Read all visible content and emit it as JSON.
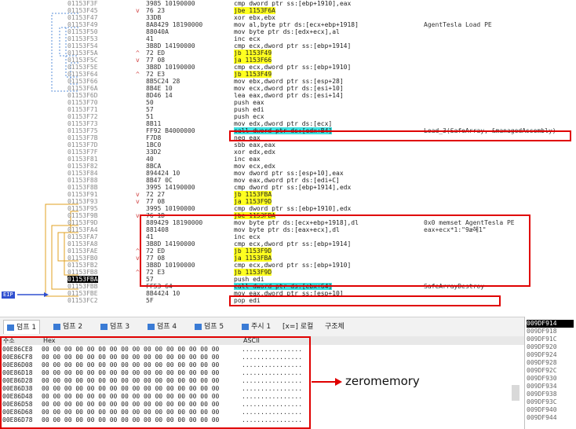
{
  "disasm": [
    {
      "addr": "01153F3F",
      "arrow": "",
      "bytes": "3985 10190000",
      "instr": "cmp dword ptr ss:[ebp+1910],eax",
      "comment": ""
    },
    {
      "addr": "01153F45",
      "arrow": "v",
      "bytes": "76 23",
      "instr": "jbe 1153F6A",
      "comment": ""
    },
    {
      "addr": "01153F47",
      "arrow": "",
      "bytes": "33DB",
      "instr": "xor ebx,ebx",
      "comment": ""
    },
    {
      "addr": "01153F49",
      "arrow": "",
      "bytes": "8A8429 18190000",
      "instr": "mov al,byte ptr ds:[ecx+ebp+1918]",
      "comment": "AgentTesla Load PE"
    },
    {
      "addr": "01153F50",
      "arrow": "",
      "bytes": "88040A",
      "instr": "mov byte ptr ds:[edx+ecx],al",
      "comment": ""
    },
    {
      "addr": "01153F53",
      "arrow": "",
      "bytes": "41",
      "instr": "inc ecx",
      "comment": ""
    },
    {
      "addr": "01153F54",
      "arrow": "",
      "bytes": "3B8D 14190000",
      "instr": "cmp ecx,dword ptr ss:[ebp+1914]",
      "comment": ""
    },
    {
      "addr": "01153F5A",
      "arrow": "^",
      "bytes": "72 ED",
      "instr": "jb 1153F49",
      "comment": ""
    },
    {
      "addr": "01153F5C",
      "arrow": "v",
      "bytes": "77 08",
      "instr": "ja 1153F66",
      "comment": ""
    },
    {
      "addr": "01153F5E",
      "arrow": "",
      "bytes": "3B8D 10190000",
      "instr": "cmp ecx,dword ptr ss:[ebp+1910]",
      "comment": ""
    },
    {
      "addr": "01153F64",
      "arrow": "^",
      "bytes": "72 E3",
      "instr": "jb 1153F49",
      "comment": ""
    },
    {
      "addr": "01153F66",
      "arrow": "",
      "bytes": "8B5C24 28",
      "instr": "mov ebx,dword ptr ss:[esp+28]",
      "comment": ""
    },
    {
      "addr": "01153F6A",
      "arrow": "",
      "bytes": "8B4E 10",
      "instr": "mov ecx,dword ptr ds:[esi+10]",
      "comment": ""
    },
    {
      "addr": "01153F6D",
      "arrow": "",
      "bytes": "8D46 14",
      "instr": "lea eax,dword ptr ds:[esi+14]",
      "comment": ""
    },
    {
      "addr": "01153F70",
      "arrow": "",
      "bytes": "50",
      "instr": "push eax",
      "comment": ""
    },
    {
      "addr": "01153F71",
      "arrow": "",
      "bytes": "57",
      "instr": "push edi",
      "comment": ""
    },
    {
      "addr": "01153F72",
      "arrow": "",
      "bytes": "51",
      "instr": "push ecx",
      "comment": ""
    },
    {
      "addr": "01153F73",
      "arrow": "",
      "bytes": "8B11",
      "instr": "mov edx,dword ptr ds:[ecx]",
      "comment": ""
    },
    {
      "addr": "01153F75",
      "arrow": "",
      "bytes": "FF92 B4000000",
      "instr": "call dword ptr ds:[edx+B4]",
      "comment": "Load_3(SafeArray, &managedAssembly)"
    },
    {
      "addr": "01153F7B",
      "arrow": "",
      "bytes": "F7D8",
      "instr": "neg eax",
      "comment": ""
    },
    {
      "addr": "01153F7D",
      "arrow": "",
      "bytes": "1BC0",
      "instr": "sbb eax,eax",
      "comment": ""
    },
    {
      "addr": "01153F7F",
      "arrow": "",
      "bytes": "33D2",
      "instr": "xor edx,edx",
      "comment": ""
    },
    {
      "addr": "01153F81",
      "arrow": "",
      "bytes": "40",
      "instr": "inc eax",
      "comment": ""
    },
    {
      "addr": "01153F82",
      "arrow": "",
      "bytes": "8BCA",
      "instr": "mov ecx,edx",
      "comment": ""
    },
    {
      "addr": "01153F84",
      "arrow": "",
      "bytes": "894424 10",
      "instr": "mov dword ptr ss:[esp+10],eax",
      "comment": ""
    },
    {
      "addr": "01153F88",
      "arrow": "",
      "bytes": "8B47 0C",
      "instr": "mov eax,dword ptr ds:[edi+C]",
      "comment": ""
    },
    {
      "addr": "01153F8B",
      "arrow": "",
      "bytes": "3995 14190000",
      "instr": "cmp dword ptr ss:[ebp+1914],edx",
      "comment": ""
    },
    {
      "addr": "01153F91",
      "arrow": "v",
      "bytes": "72 27",
      "instr": "jb 1153FBA",
      "comment": ""
    },
    {
      "addr": "01153F93",
      "arrow": "v",
      "bytes": "77 08",
      "instr": "ja 1153F9D",
      "comment": ""
    },
    {
      "addr": "01153F95",
      "arrow": "",
      "bytes": "3995 10190000",
      "instr": "cmp dword ptr ss:[ebp+1910],edx",
      "comment": ""
    },
    {
      "addr": "01153F9B",
      "arrow": "v",
      "bytes": "76 1D",
      "instr": "jbe 1153FBA",
      "comment": ""
    },
    {
      "addr": "01153F9D",
      "arrow": "",
      "bytes": "889429 18190000",
      "instr": "mov byte ptr ds:[ecx+ebp+1918],dl",
      "comment": "0x0 memset AgentTesla PE"
    },
    {
      "addr": "01153FA4",
      "arrow": "",
      "bytes": "881408",
      "instr": "mov byte ptr ds:[eax+ecx],dl",
      "comment": "eax+ecx*1:\"9æ혜1\""
    },
    {
      "addr": "01153FA7",
      "arrow": "",
      "bytes": "41",
      "instr": "inc ecx",
      "comment": ""
    },
    {
      "addr": "01153FA8",
      "arrow": "",
      "bytes": "3B8D 14190000",
      "instr": "cmp ecx,dword ptr ss:[ebp+1914]",
      "comment": ""
    },
    {
      "addr": "01153FAE",
      "arrow": "^",
      "bytes": "72 ED",
      "instr": "jb 1153F9D",
      "comment": ""
    },
    {
      "addr": "01153FB0",
      "arrow": "v",
      "bytes": "77 08",
      "instr": "ja 1153FBA",
      "comment": ""
    },
    {
      "addr": "01153FB2",
      "arrow": "",
      "bytes": "3B8D 10190000",
      "instr": "cmp ecx,dword ptr ss:[ebp+1910]",
      "comment": ""
    },
    {
      "addr": "01153FB8",
      "arrow": "^",
      "bytes": "72 E3",
      "instr": "jb 1153F9D",
      "comment": ""
    },
    {
      "addr": "01153FBA",
      "arrow": "",
      "bytes": "57",
      "instr": "push edi",
      "comment": ""
    },
    {
      "addr": "01153FBB",
      "arrow": "",
      "bytes": "FF53 64",
      "instr": "call dword ptr ds:[ebx+64]",
      "comment": "SafeArrayDestroy"
    },
    {
      "addr": "01153FBE",
      "arrow": "",
      "bytes": "8B4424 10",
      "instr": "mov eax,dword ptr ss:[esp+10]",
      "comment": ""
    },
    {
      "addr": "01153FC2",
      "arrow": "",
      "bytes": "5F",
      "instr": "pop edi",
      "comment": ""
    }
  ],
  "eip_label": "EIP",
  "tabs": [
    {
      "label": "덤프 1"
    },
    {
      "label": "덤프 2"
    },
    {
      "label": "덤프 3"
    },
    {
      "label": "덤프 4"
    },
    {
      "label": "덤프 5"
    },
    {
      "label": "주시 1"
    },
    {
      "label": "[x=] 로컬"
    },
    {
      "label": "구조체"
    }
  ],
  "dump": {
    "head_addr": "주소",
    "head_hex": "Hex",
    "head_ascii": "ASCII",
    "rows": [
      {
        "addr": "00E86CE8",
        "hex": "00 00 00 00 00 00 00 00 00 00 00 00 00 00 00 00",
        "ascii": "................"
      },
      {
        "addr": "00E86CF8",
        "hex": "00 00 00 00 00 00 00 00 00 00 00 00 00 00 00 00",
        "ascii": "................"
      },
      {
        "addr": "00E86D08",
        "hex": "00 00 00 00 00 00 00 00 00 00 00 00 00 00 00 00",
        "ascii": "................"
      },
      {
        "addr": "00E86D18",
        "hex": "00 00 00 00 00 00 00 00 00 00 00 00 00 00 00 00",
        "ascii": "................"
      },
      {
        "addr": "00E86D28",
        "hex": "00 00 00 00 00 00 00 00 00 00 00 00 00 00 00 00",
        "ascii": "................"
      },
      {
        "addr": "00E86D38",
        "hex": "00 00 00 00 00 00 00 00 00 00 00 00 00 00 00 00",
        "ascii": "................"
      },
      {
        "addr": "00E86D48",
        "hex": "00 00 00 00 00 00 00 00 00 00 00 00 00 00 00 00",
        "ascii": "................"
      },
      {
        "addr": "00E86D58",
        "hex": "00 00 00 00 00 00 00 00 00 00 00 00 00 00 00 00",
        "ascii": "................"
      },
      {
        "addr": "00E86D68",
        "hex": "00 00 00 00 00 00 00 00 00 00 00 00 00 00 00 00",
        "ascii": "................"
      },
      {
        "addr": "00E86D78",
        "hex": "00 00 00 00 00 00 00 00 00 00 00 00 00 00 00 00",
        "ascii": "................"
      }
    ]
  },
  "stack": [
    "009DF914",
    "009DF918",
    "009DF91C",
    "009DF920",
    "009DF924",
    "009DF928",
    "009DF92C",
    "009DF930",
    "009DF934",
    "009DF938",
    "009DF93C",
    "009DF940",
    "009DF944"
  ],
  "annotation": "zeromemory",
  "colors": {
    "highlight_yellow": "#ffff20",
    "highlight_cyan": "#40e0e0",
    "annotation_red": "#e00000",
    "eip_blue": "#3050d0"
  }
}
